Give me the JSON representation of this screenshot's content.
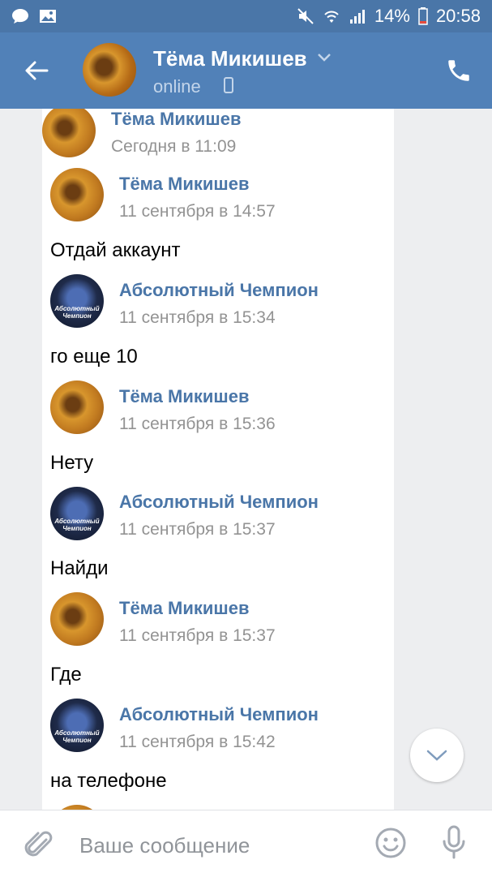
{
  "status_bar": {
    "battery": "14%",
    "time": "20:58"
  },
  "header": {
    "title": "Тёма Микишев",
    "status": "online"
  },
  "quoted": {
    "author": "Тёма Микишев",
    "time": "Сегодня в 11:09"
  },
  "messages": [
    {
      "author": "Тёма Микишев",
      "time": "11 сентября в 14:57",
      "text": "Отдай аккаунт",
      "avatar": "tema"
    },
    {
      "author": "Абсолютный Чемпион",
      "time": "11 сентября в 15:34",
      "text": "го еще 10",
      "avatar": "champ"
    },
    {
      "author": "Тёма Микишев",
      "time": "11 сентября в 15:36",
      "text": "Нету",
      "avatar": "tema"
    },
    {
      "author": "Абсолютный Чемпион",
      "time": "11 сентября в 15:37",
      "text": "Найди",
      "avatar": "champ"
    },
    {
      "author": "Тёма Микишев",
      "time": "11 сентября в 15:37",
      "text": "Где",
      "avatar": "tema"
    },
    {
      "author": "Абсолютный Чемпион",
      "time": "11 сентября в 15:42",
      "text": "на телефоне",
      "avatar": "champ"
    }
  ],
  "champ_avatar_label": "Абсолютный Чемпион",
  "input": {
    "placeholder": "Ваше сообщение"
  },
  "colors": {
    "header": "#5181b8",
    "statusbar": "#4a76a8",
    "author": "#4a76a8",
    "time": "#939393"
  }
}
